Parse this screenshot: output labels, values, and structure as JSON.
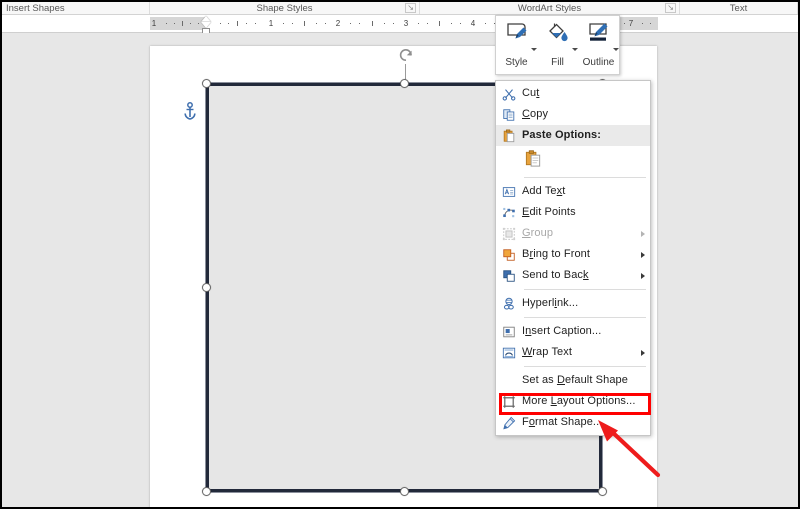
{
  "app": {
    "product": "Microsoft Word",
    "context": "Drawing Tools - Format tab (shape selected)"
  },
  "ribbon": {
    "groups": [
      {
        "label": "Insert Shapes",
        "dialog_launcher": false
      },
      {
        "label": "Shape Styles",
        "dialog_launcher": true,
        "dialog_glyph": "↘"
      },
      {
        "label": "WordArt Styles",
        "dialog_launcher": true,
        "dialog_glyph": "↘"
      },
      {
        "label": "Text",
        "dialog_launcher": false
      }
    ]
  },
  "ruler": {
    "unit": "inches",
    "tick_numbers": [
      "1",
      "1",
      "2",
      "3",
      "4",
      "7"
    ],
    "left_margin_shaded": true,
    "indent_marker": "hourglass-indent-marker"
  },
  "mini_toolbar": {
    "items": [
      {
        "label": "Style",
        "icon": "shape-style-icon",
        "has_dropdown": true
      },
      {
        "label": "Fill",
        "icon": "fill-bucket-icon",
        "has_dropdown": true
      },
      {
        "label": "Outline",
        "icon": "outline-pen-icon",
        "has_dropdown": true
      }
    ]
  },
  "context_menu": {
    "items": [
      {
        "label": "Cut",
        "icon": "scissors-icon",
        "accel": "t",
        "submenu": false,
        "disabled": false,
        "type": "item"
      },
      {
        "label": "Copy",
        "icon": "copy-icon",
        "accel": "C",
        "submenu": false,
        "disabled": false,
        "type": "item"
      },
      {
        "label": "Paste Options:",
        "icon": "paste-icon",
        "submenu": false,
        "disabled": false,
        "type": "header"
      },
      {
        "label": "",
        "icon": "paste-keep-source-formatting-icon",
        "type": "paste-gallery"
      },
      {
        "type": "separator"
      },
      {
        "label": "Add Text",
        "icon": "add-text-icon",
        "accel": "x",
        "submenu": false,
        "disabled": false,
        "type": "item"
      },
      {
        "label": "Edit Points",
        "icon": "edit-points-icon",
        "accel": "E",
        "submenu": false,
        "disabled": false,
        "type": "item"
      },
      {
        "label": "Group",
        "icon": "group-icon",
        "accel": "G",
        "submenu": true,
        "disabled": true,
        "type": "item"
      },
      {
        "label": "Bring to Front",
        "icon": "bring-to-front-icon",
        "accel": "r",
        "submenu": true,
        "disabled": false,
        "type": "item"
      },
      {
        "label": "Send to Back",
        "icon": "send-to-back-icon",
        "accel": "k",
        "submenu": true,
        "disabled": false,
        "type": "item"
      },
      {
        "type": "separator"
      },
      {
        "label": "Hyperlink...",
        "icon": "hyperlink-icon",
        "accel": "i",
        "submenu": false,
        "disabled": false,
        "type": "item"
      },
      {
        "type": "separator"
      },
      {
        "label": "Insert Caption...",
        "icon": "insert-caption-icon",
        "accel": "n",
        "submenu": false,
        "disabled": false,
        "type": "item"
      },
      {
        "label": "Wrap Text",
        "icon": "wrap-text-icon",
        "accel": "W",
        "submenu": true,
        "disabled": false,
        "type": "item"
      },
      {
        "type": "separator"
      },
      {
        "label": "Set as Default Shape",
        "icon": null,
        "accel": "D",
        "submenu": false,
        "disabled": false,
        "type": "item"
      },
      {
        "label": "More Layout Options...",
        "icon": "more-layout-options-icon",
        "accel": "L",
        "submenu": false,
        "disabled": false,
        "type": "item"
      },
      {
        "label": "Format Shape...",
        "icon": "format-shape-icon",
        "accel": "o",
        "submenu": false,
        "disabled": false,
        "type": "item",
        "highlighted": true
      }
    ]
  },
  "shape": {
    "type": "rectangle",
    "state": "selected",
    "fill_color": "#e6e6e6",
    "border_color": "#22293a",
    "handles": 8,
    "rotation_handle": true,
    "anchor_icon": "object-anchor-icon"
  },
  "annotation": {
    "highlight_target": "Format Shape...",
    "highlight_color": "#ff0000",
    "arrow_color": "#ff0000",
    "arrow_direction": "up-left"
  }
}
